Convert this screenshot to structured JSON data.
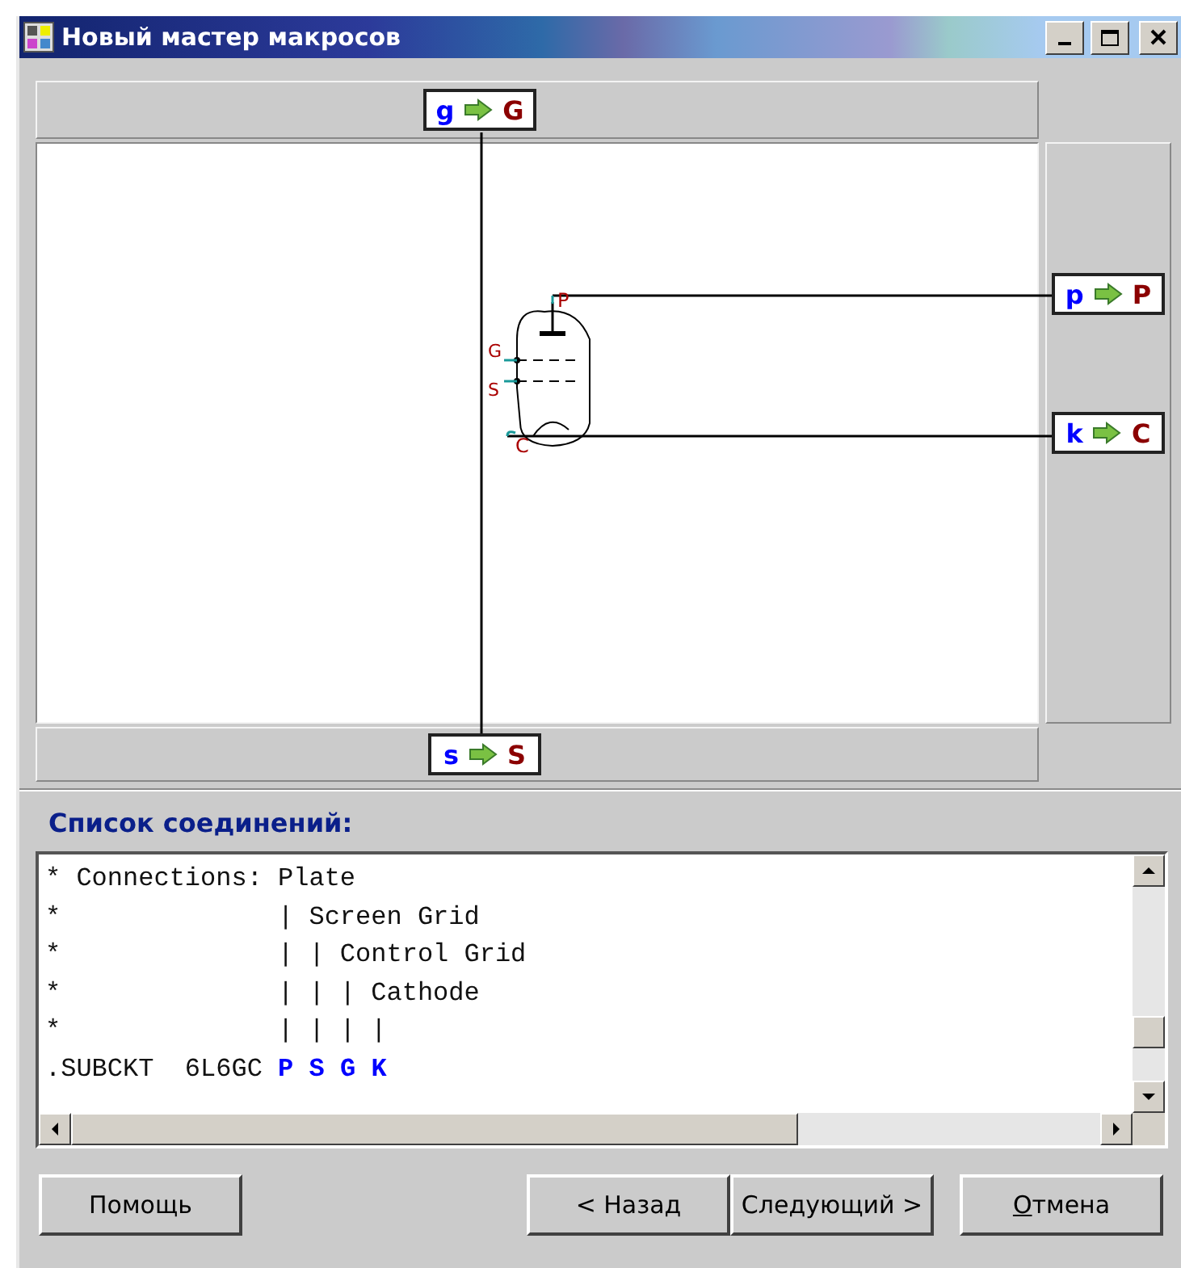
{
  "window": {
    "title": "Новый мастер макросов"
  },
  "diagram": {
    "top_pin": {
      "from": "g",
      "to": "G"
    },
    "right_pins": [
      {
        "from": "p",
        "to": "P"
      },
      {
        "from": "k",
        "to": "C"
      }
    ],
    "bottom_pin": {
      "from": "s",
      "to": "S"
    },
    "tube_labels": {
      "plate": "P",
      "grid": "G",
      "screen": "S",
      "cathode": "C"
    }
  },
  "netlist": {
    "label": "Список соединений:",
    "lines": [
      "* Connections: Plate",
      "*              | Screen Grid",
      "*              | | Control Grid",
      "*              | | | Cathode",
      "*              | | | |",
      ".SUBCKT  6L6GC **P** **S** **G** **K**"
    ]
  },
  "buttons": [
    {
      "label": "Помощь",
      "first_letter_underlined": false
    },
    {
      "label": "< Назад",
      "first_letter_underlined": false
    },
    {
      "label": "Следующий >",
      "first_letter_underlined": false
    },
    {
      "label": "Отмена",
      "first_letter_underlined": true
    }
  ]
}
